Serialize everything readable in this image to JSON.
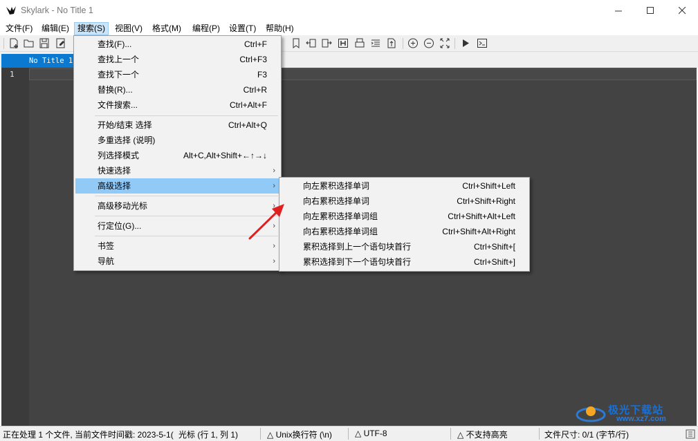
{
  "window": {
    "title": "Skylark - No Title 1"
  },
  "menubar": [
    "文件(F)",
    "编辑(E)",
    "搜索(S)",
    "视图(V)",
    "格式(M)",
    "编程(P)",
    "设置(T)",
    "帮助(H)"
  ],
  "tab": {
    "label": "No Title 1"
  },
  "editor": {
    "line_number": "1"
  },
  "search_menu": [
    {
      "label": "查找(F)...",
      "shortcut": "Ctrl+F"
    },
    {
      "label": "查找上一个",
      "shortcut": "Ctrl+F3"
    },
    {
      "label": "查找下一个",
      "shortcut": "F3"
    },
    {
      "label": "替换(R)...",
      "shortcut": "Ctrl+R"
    },
    {
      "label": "文件搜索...",
      "shortcut": "Ctrl+Alt+F"
    },
    {
      "label": "开始/结束 选择",
      "shortcut": "Ctrl+Alt+Q"
    },
    {
      "label": "多重选择 (说明)",
      "shortcut": ""
    },
    {
      "label": "列选择模式",
      "shortcut": "Alt+C,Alt+Shift+←↑→↓"
    },
    {
      "label": "快速选择",
      "shortcut": ""
    },
    {
      "label": "高级选择",
      "shortcut": ""
    },
    {
      "label": "高级移动光标",
      "shortcut": ""
    },
    {
      "label": "行定位(G)...",
      "shortcut": ""
    },
    {
      "label": "书签",
      "shortcut": ""
    },
    {
      "label": "导航",
      "shortcut": ""
    }
  ],
  "advanced_select_submenu": [
    {
      "label": "向左累积选择单词",
      "shortcut": "Ctrl+Shift+Left"
    },
    {
      "label": "向右累积选择单词",
      "shortcut": "Ctrl+Shift+Right"
    },
    {
      "label": "向左累积选择单词组",
      "shortcut": "Ctrl+Shift+Alt+Left"
    },
    {
      "label": "向右累积选择单词组",
      "shortcut": "Ctrl+Shift+Alt+Right"
    },
    {
      "label": "累积选择到上一个语句块首行",
      "shortcut": "Ctrl+Shift+["
    },
    {
      "label": "累积选择到下一个语句块首行",
      "shortcut": "Ctrl+Shift+]"
    }
  ],
  "statusbar": {
    "processing": "正在处理 1 个文件, 当前文件时间戳: 2023-5-1(",
    "cursor": "光标 (行 1, 列 1)",
    "line_ending": "Unix换行符 (\\n)",
    "encoding": "UTF-8",
    "highlight": "不支持高亮",
    "file_size": "文件尺寸: 0/1 (字节/行)"
  },
  "watermark": {
    "name": "极光下载站",
    "url": "www.xz7.com"
  },
  "colors": {
    "accent": "#0b79d0",
    "highlight": "#91c9f7",
    "editor_bg": "#434343",
    "arrow": "#e02020"
  }
}
